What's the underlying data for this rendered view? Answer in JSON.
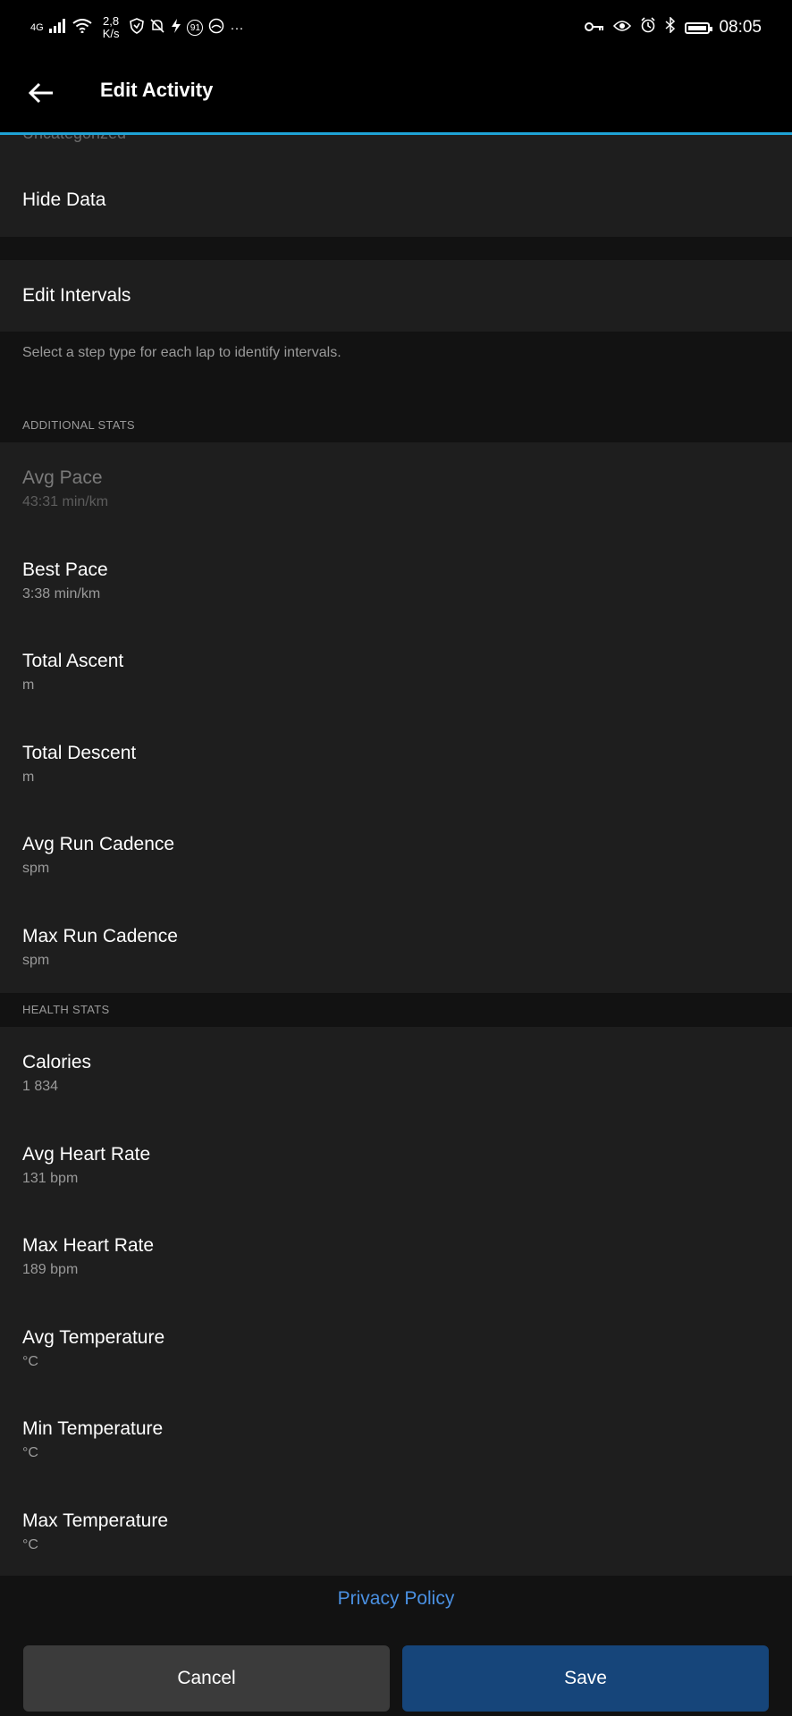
{
  "status_bar": {
    "network": "4G",
    "speed_top": "2,8",
    "speed_bottom": "K/s",
    "notif_count": "91",
    "more": "···",
    "time": "08:05"
  },
  "app_bar": {
    "title": "Edit Activity"
  },
  "top_section": {
    "cut_text": "Uncategorized",
    "hide_data_label": "Hide Data"
  },
  "intervals": {
    "edit_label": "Edit Intervals",
    "help_text": "Select a step type for each lap to identify intervals."
  },
  "additional_stats": {
    "header": "ADDITIONAL STATS",
    "items": [
      {
        "label": "Avg Pace",
        "value": "43:31 min/km"
      },
      {
        "label": "Best Pace",
        "value": "3:38 min/km"
      },
      {
        "label": "Total Ascent",
        "value": "m"
      },
      {
        "label": "Total Descent",
        "value": "m"
      },
      {
        "label": "Avg Run Cadence",
        "value": "spm"
      },
      {
        "label": "Max Run Cadence",
        "value": "spm"
      }
    ]
  },
  "health_stats": {
    "header": "HEALTH STATS",
    "items": [
      {
        "label": "Calories",
        "value": "1 834"
      },
      {
        "label": "Avg Heart Rate",
        "value": "131 bpm"
      },
      {
        "label": "Max Heart Rate",
        "value": "189 bpm"
      },
      {
        "label": "Avg Temperature",
        "value": "°C"
      },
      {
        "label": "Min Temperature",
        "value": "°C"
      },
      {
        "label": "Max Temperature",
        "value": "°C"
      }
    ]
  },
  "footer": {
    "privacy_label": "Privacy Policy",
    "cancel_label": "Cancel",
    "save_label": "Save"
  },
  "colors": {
    "accent_line": "#1fa3d6",
    "link": "#4a90e2",
    "save_button": "#16457a",
    "cancel_button": "#3b3b3b"
  }
}
